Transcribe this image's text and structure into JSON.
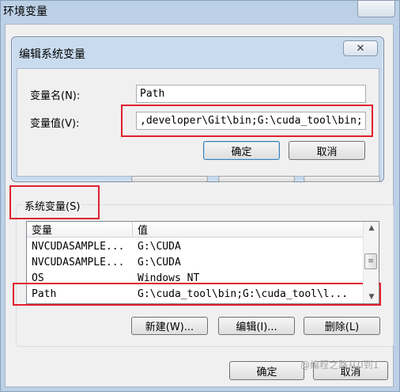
{
  "outer_window": {
    "title": "环境变量",
    "ok_label": "确定",
    "cancel_label": "取消"
  },
  "edit_dialog": {
    "title": "编辑系统变量",
    "close_glyph": "✕",
    "name_label": "变量名(N):",
    "name_value": "Path",
    "value_label": "变量值(V):",
    "value_value": ",developer\\Git\\bin;G:\\cuda_tool\\bin;",
    "ok_label": "确定",
    "cancel_label": "取消"
  },
  "system_vars": {
    "group_label": "系统变量(S)",
    "columns": [
      "变量",
      "值"
    ],
    "rows": [
      {
        "name": "NVCUDASAMPLE...",
        "value": "G:\\CUDA"
      },
      {
        "name": "NVCUDASAMPLE...",
        "value": "G:\\CUDA"
      },
      {
        "name": "OS",
        "value": "Windows_NT"
      },
      {
        "name": "Path",
        "value": "G:\\cuda_tool\\bin;G:\\cuda_tool\\l..."
      }
    ],
    "new_label": "新建(W)...",
    "edit_label": "编辑(I)...",
    "delete_label": "删除(L)"
  },
  "watermark": "@编程之路从0到1",
  "colors": {
    "highlight_red": "#e0202e",
    "title_bar": "#c9dbee"
  }
}
